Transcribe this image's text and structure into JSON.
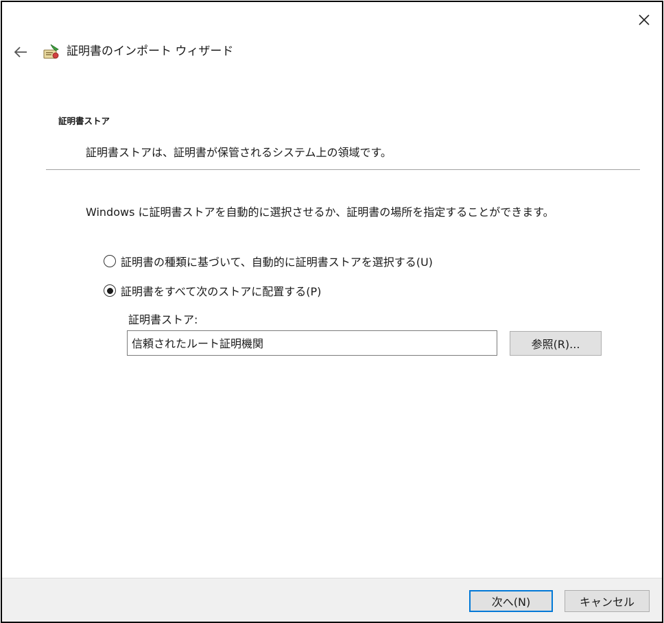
{
  "wizard": {
    "title": "証明書のインポート ウィザード",
    "icons": {
      "back": "back-arrow-icon",
      "close": "close-icon",
      "wizard": "certificate-wizard-icon"
    }
  },
  "page": {
    "title": "証明書ストア",
    "description": "証明書ストアは、証明書が保管されるシステム上の領域です。"
  },
  "content": {
    "intro": "Windows に証明書ストアを自動的に選択させるか、証明書の場所を指定することができます。",
    "options": [
      {
        "label": "証明書の種類に基づいて、自動的に証明書ストアを選択する(U)",
        "selected": false
      },
      {
        "label": "証明書をすべて次のストアに配置する(P)",
        "selected": true
      }
    ],
    "store_label": "証明書ストア:",
    "store_value": "信頼されたルート証明機関",
    "browse_label": "参照(R)..."
  },
  "footer": {
    "next_label": "次へ(N)",
    "cancel_label": "キャンセル"
  },
  "colors": {
    "accent": "#0078d7",
    "button_bg": "#e1e1e1",
    "footer_bg": "#f0f0f0"
  }
}
